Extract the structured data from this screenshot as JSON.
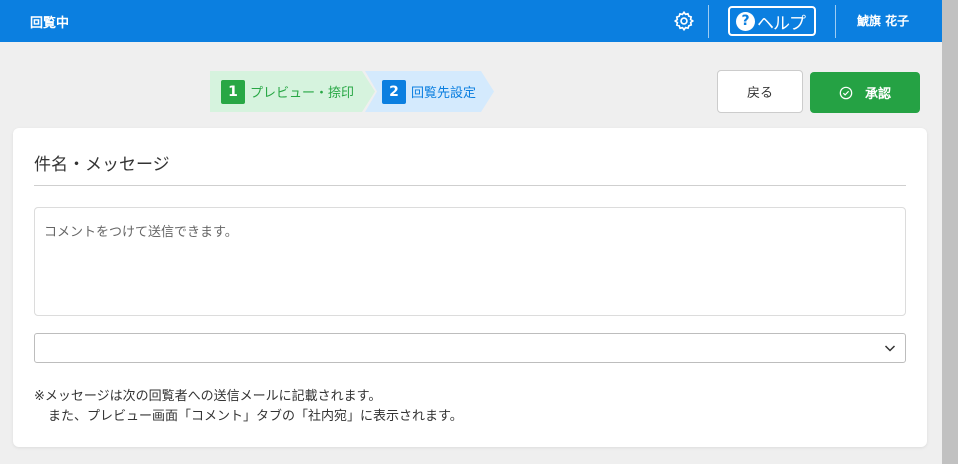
{
  "header": {
    "title": "回覧中",
    "help_label": "ヘルプ",
    "user_name": "鯱旗 花子"
  },
  "steps": [
    {
      "number": "1",
      "label": "プレビュー・捺印"
    },
    {
      "number": "2",
      "label": "回覧先設定"
    }
  ],
  "actions": {
    "back_label": "戻る",
    "approve_label": "承認"
  },
  "card": {
    "title": "件名・メッセージ",
    "message_placeholder": "コメントをつけて送信できます。",
    "select_value": "",
    "note_line1": "※メッセージは次の回覧者への送信メールに記載されます。",
    "note_line2": "また、プレビュー画面「コメント」タブの「社内宛」に表示されます。"
  },
  "colors": {
    "header_bg": "#0b7fe0",
    "approve_bg": "#25a244",
    "step1_bg": "#d6f3de",
    "step2_bg": "#d4eafd"
  },
  "icons": [
    "gear-icon",
    "help-icon",
    "check-circle-icon",
    "chevron-down-icon"
  ]
}
